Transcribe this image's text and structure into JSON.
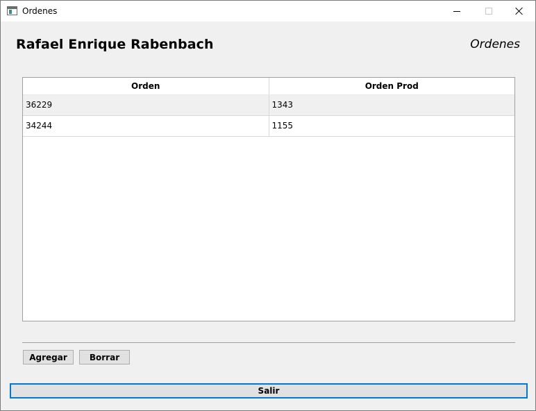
{
  "window": {
    "title": "Ordenes"
  },
  "header": {
    "user_name": "Rafael Enrique Rabenbach",
    "section_title": "Ordenes"
  },
  "table": {
    "columns": [
      "Orden",
      "Orden Prod"
    ],
    "rows": [
      [
        "36229",
        "1343"
      ],
      [
        "34244",
        "1155"
      ]
    ]
  },
  "actions": {
    "add_label": "Agregar",
    "delete_label": "Borrar",
    "exit_label": "Salir"
  },
  "colors": {
    "focus_border": "#0078d7",
    "window_bg": "#f0f0f0"
  }
}
